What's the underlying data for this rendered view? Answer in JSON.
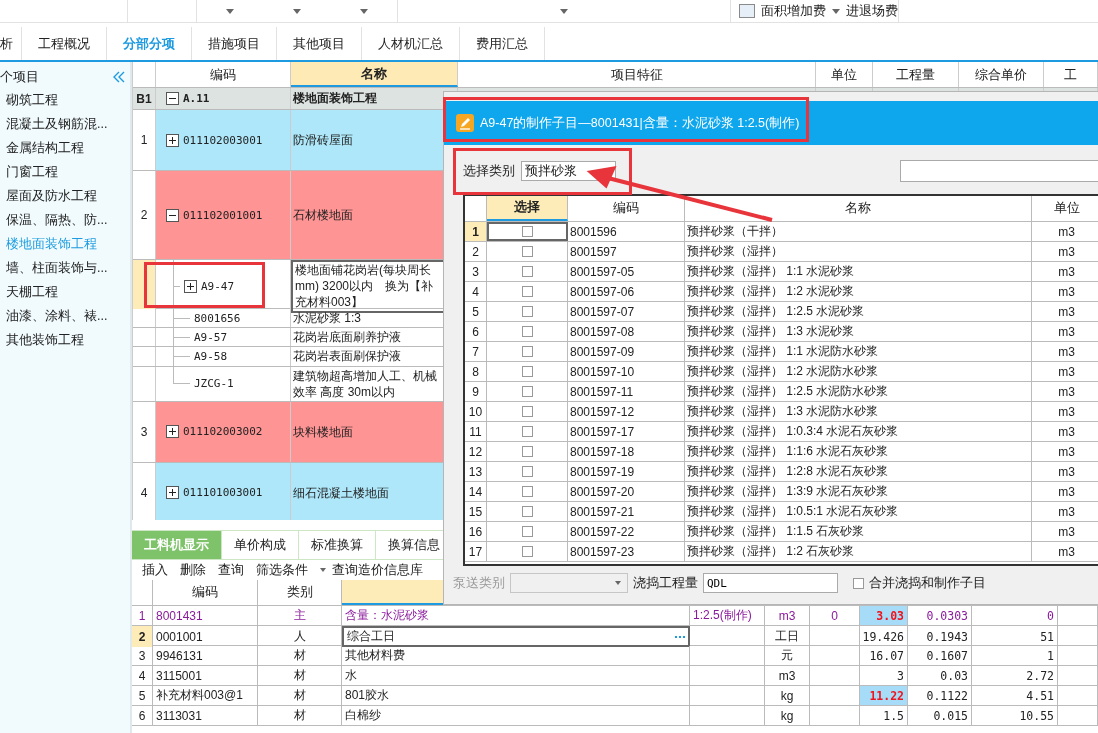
{
  "toolbar": {
    "items": [
      {
        "label": "面积增加费",
        "kind": "dropdown"
      },
      {
        "label": "进退场费",
        "kind": "button"
      }
    ]
  },
  "tabs": [
    {
      "label": "析",
      "selected": false
    },
    {
      "label": "工程概况",
      "selected": false
    },
    {
      "label": "分部分项",
      "selected": true
    },
    {
      "label": "措施项目",
      "selected": false
    },
    {
      "label": "其他项目",
      "selected": false
    },
    {
      "label": "人材机汇总",
      "selected": false
    },
    {
      "label": "费用汇总",
      "selected": false
    }
  ],
  "sidebar": {
    "title": "个项目",
    "items": [
      {
        "label": "砌筑工程",
        "selected": false
      },
      {
        "label": "混凝土及钢筋混...",
        "selected": false
      },
      {
        "label": "金属结构工程",
        "selected": false
      },
      {
        "label": "门窗工程",
        "selected": false
      },
      {
        "label": "屋面及防水工程",
        "selected": false
      },
      {
        "label": "保温、隔热、防...",
        "selected": false
      },
      {
        "label": "楼地面装饰工程",
        "selected": true
      },
      {
        "label": "墙、柱面装饰与...",
        "selected": false
      },
      {
        "label": "天棚工程",
        "selected": false
      },
      {
        "label": "油漆、涂料、裱...",
        "selected": false
      },
      {
        "label": "其他装饰工程",
        "selected": false
      }
    ]
  },
  "main_grid": {
    "columns": [
      {
        "label": "编码",
        "selected": false
      },
      {
        "label": "名称",
        "selected": true
      },
      {
        "label": "项目特征",
        "selected": false
      },
      {
        "label": "单位",
        "selected": false
      },
      {
        "label": "工程量",
        "selected": false
      },
      {
        "label": "综合单价",
        "selected": false
      },
      {
        "label": "工",
        "selected": false
      }
    ],
    "rows": [
      {
        "kind": "section",
        "number": "B1",
        "code": "A.11",
        "name": "楼地面装饰工程",
        "expanded": true
      },
      {
        "kind": "list",
        "number": "1",
        "code": "011102003001",
        "name": "防滑砖屋面",
        "expanded": false,
        "color": "#aee7f9"
      },
      {
        "kind": "list",
        "number": "2",
        "code": "011102001001",
        "name": "石材楼地面",
        "expanded": true,
        "color": "#ff9494",
        "children": [
          {
            "kind": "item",
            "code": "A9-47",
            "name": "楼地面铺花岗岩(每块周长mm) 3200以内　换为【补充材料003】",
            "expanded": false,
            "selected": true
          },
          {
            "kind": "resource",
            "code": "8001656",
            "name": "水泥砂浆 1:3",
            "selected": false
          },
          {
            "kind": "resource",
            "code": "A9-57",
            "name": "花岗岩底面刷养护液",
            "selected": false
          },
          {
            "kind": "resource",
            "code": "A9-58",
            "name": "花岗岩表面刷保护液",
            "selected": false
          },
          {
            "kind": "resource",
            "code": "JZCG-1",
            "name": "建筑物超高增加人工、机械效率 高度 30m以内",
            "selected": false
          }
        ]
      },
      {
        "kind": "list",
        "number": "3",
        "code": "011102003002",
        "name": "块料楼地面",
        "expanded": false,
        "color": "#ff9494"
      },
      {
        "kind": "list",
        "number": "4",
        "code": "011101003001",
        "name": "细石混凝土楼地面",
        "expanded": false,
        "color": "#aee7f9"
      }
    ]
  },
  "bottom_panel": {
    "tabs": [
      {
        "label": "工料机显示",
        "selected": true
      },
      {
        "label": "单价构成",
        "selected": false
      },
      {
        "label": "标准换算",
        "selected": false
      },
      {
        "label": "换算信息",
        "selected": false
      }
    ],
    "toolbar": [
      {
        "label": "插入",
        "kind": "button"
      },
      {
        "label": "删除",
        "kind": "button"
      },
      {
        "label": "查询",
        "kind": "button"
      },
      {
        "label": "筛选条件",
        "kind": "dropdown"
      },
      {
        "label": "查询造价信息库",
        "kind": "button"
      }
    ],
    "columns": [
      {
        "label": "编码",
        "selected": false
      },
      {
        "label": "类别",
        "selected": false
      },
      {
        "selected": true
      }
    ],
    "rows": [
      {
        "kind": "main",
        "number": "1",
        "code": "8001431",
        "type": "主",
        "name": "含量：水泥砂浆",
        "spec": "1:2.5(制作)",
        "unit": "m3",
        "column_7": "0",
        "quantity": "3.03",
        "column_9": "0.0303",
        "column_10": "0",
        "selected": false,
        "highlighted": true
      },
      {
        "kind": "normal",
        "number": "2",
        "code": "0001001",
        "type": "人",
        "name": "综合工日",
        "unit": "工日",
        "quantity": "19.426",
        "column_9": "0.1943",
        "column_10": "51",
        "selected": true,
        "highlighted": false
      },
      {
        "kind": "normal",
        "number": "3",
        "code": "9946131",
        "type": "材",
        "name": "其他材料费",
        "unit": "元",
        "quantity": "16.07",
        "column_9": "0.1607",
        "column_10": "1",
        "selected": false,
        "highlighted": false
      },
      {
        "kind": "normal",
        "number": "4",
        "code": "3115001",
        "type": "材",
        "name": "水",
        "unit": "m3",
        "quantity": "3",
        "column_9": "0.03",
        "column_10": "2.72",
        "selected": false,
        "highlighted": false
      },
      {
        "kind": "normal",
        "number": "5",
        "code": "补充材料003@1",
        "type": "材",
        "name": "801胶水",
        "unit": "kg",
        "quantity": "11.22",
        "column_9": "0.1122",
        "column_10": "4.51",
        "selected": false,
        "highlighted": true
      },
      {
        "kind": "normal",
        "number": "6",
        "code": "3113031",
        "type": "材",
        "name": "白棉纱",
        "unit": "kg",
        "quantity": "1.5",
        "column_9": "0.015",
        "column_10": "10.55",
        "selected": false,
        "highlighted": false
      }
    ]
  },
  "dialog": {
    "title": "A9-47的制作子目—8001431|含量：水泥砂浆 1:2.5(制作)",
    "category_label": "选择类别",
    "category": "预拌砂浆",
    "columns": [
      {
        "label": "选择",
        "selected": true
      },
      {
        "label": "编码",
        "selected": false
      },
      {
        "label": "名称",
        "selected": false
      },
      {
        "label": "单位",
        "selected": false
      }
    ],
    "rows": [
      {
        "number": "1",
        "checked": false,
        "code": "8001596",
        "name": "预拌砂浆（干拌）",
        "unit": "m3",
        "selected": true
      },
      {
        "number": "2",
        "checked": false,
        "code": "8001597",
        "name": "预拌砂浆（湿拌）",
        "unit": "m3",
        "selected": false
      },
      {
        "number": "3",
        "checked": false,
        "code": "8001597-05",
        "name": "预拌砂浆（湿拌） 1:1 水泥砂浆",
        "unit": "m3",
        "selected": false
      },
      {
        "number": "4",
        "checked": false,
        "code": "8001597-06",
        "name": "预拌砂浆（湿拌） 1:2 水泥砂浆",
        "unit": "m3",
        "selected": false
      },
      {
        "number": "5",
        "checked": false,
        "code": "8001597-07",
        "name": "预拌砂浆（湿拌） 1:2.5 水泥砂浆",
        "unit": "m3",
        "selected": false
      },
      {
        "number": "6",
        "checked": false,
        "code": "8001597-08",
        "name": "预拌砂浆（湿拌） 1:3 水泥砂浆",
        "unit": "m3",
        "selected": false
      },
      {
        "number": "7",
        "checked": false,
        "code": "8001597-09",
        "name": "预拌砂浆（湿拌） 1:1 水泥防水砂浆",
        "unit": "m3",
        "selected": false
      },
      {
        "number": "8",
        "checked": false,
        "code": "8001597-10",
        "name": "预拌砂浆（湿拌） 1:2 水泥防水砂浆",
        "unit": "m3",
        "selected": false
      },
      {
        "number": "9",
        "checked": false,
        "code": "8001597-11",
        "name": "预拌砂浆（湿拌） 1:2.5 水泥防水砂浆",
        "unit": "m3",
        "selected": false
      },
      {
        "number": "10",
        "checked": false,
        "code": "8001597-12",
        "name": "预拌砂浆（湿拌） 1:3 水泥防水砂浆",
        "unit": "m3",
        "selected": false
      },
      {
        "number": "11",
        "checked": false,
        "code": "8001597-17",
        "name": "预拌砂浆（湿拌） 1:0.3:4 水泥石灰砂浆",
        "unit": "m3",
        "selected": false
      },
      {
        "number": "12",
        "checked": false,
        "code": "8001597-18",
        "name": "预拌砂浆（湿拌） 1:1:6 水泥石灰砂浆",
        "unit": "m3",
        "selected": false
      },
      {
        "number": "13",
        "checked": false,
        "code": "8001597-19",
        "name": "预拌砂浆（湿拌） 1:2:8 水泥石灰砂浆",
        "unit": "m3",
        "selected": false
      },
      {
        "number": "14",
        "checked": false,
        "code": "8001597-20",
        "name": "预拌砂浆（湿拌） 1:3:9 水泥石灰砂浆",
        "unit": "m3",
        "selected": false
      },
      {
        "number": "15",
        "checked": false,
        "code": "8001597-21",
        "name": "预拌砂浆（湿拌） 1:0.5:1 水泥石灰砂浆",
        "unit": "m3",
        "selected": false
      },
      {
        "number": "16",
        "checked": false,
        "code": "8001597-22",
        "name": "预拌砂浆（湿拌） 1:1.5 石灰砂浆",
        "unit": "m3",
        "selected": false
      },
      {
        "number": "17",
        "checked": false,
        "code": "8001597-23",
        "name": "预拌砂浆（湿拌） 1:2 石灰砂浆",
        "unit": "m3",
        "selected": false
      }
    ],
    "pump_label": "泵送类别",
    "pump_disabled": true,
    "pour_label": "浇捣工程量",
    "pour_value": "QDL",
    "merge_label": "合并浇捣和制作子目",
    "merge_checked": false
  }
}
